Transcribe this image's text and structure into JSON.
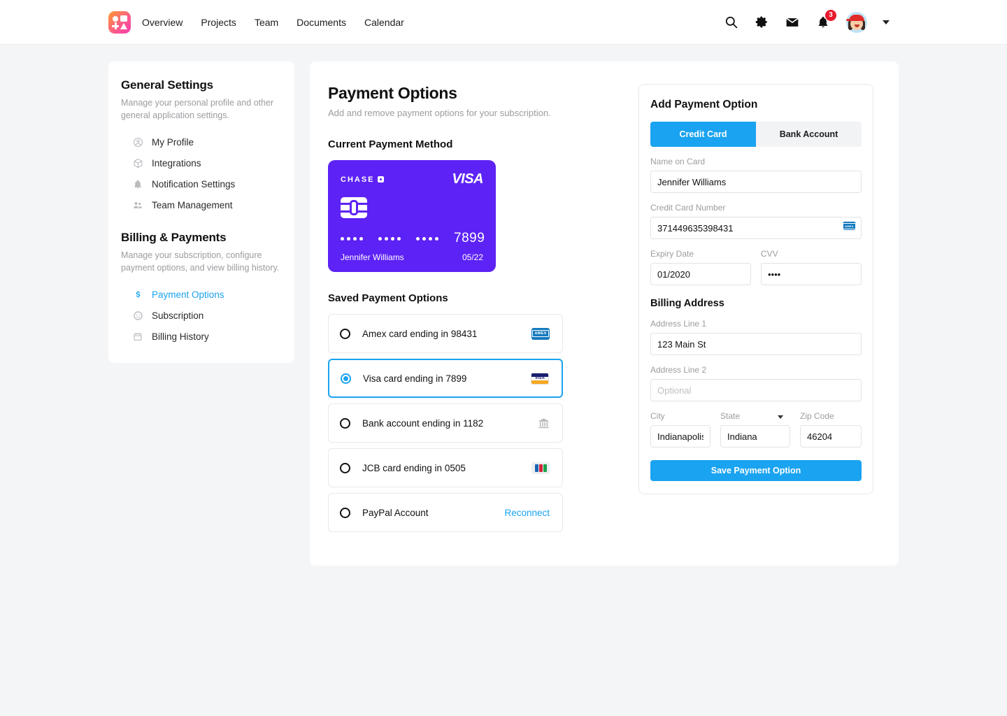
{
  "header": {
    "logo_icon": "app-logo",
    "nav": [
      {
        "label": "Overview"
      },
      {
        "label": "Projects"
      },
      {
        "label": "Team"
      },
      {
        "label": "Documents"
      },
      {
        "label": "Calendar"
      }
    ],
    "icons": {
      "search": "search-icon",
      "settings": "gear-icon",
      "mail": "mail-icon",
      "notifications": "bell-icon"
    },
    "notification_count": "3"
  },
  "sidebar": {
    "general": {
      "title": "General Settings",
      "description": "Manage your personal profile and other general application settings.",
      "items": [
        {
          "label": "My Profile",
          "icon": "user-circle-icon",
          "active": false
        },
        {
          "label": "Integrations",
          "icon": "box-icon",
          "active": false
        },
        {
          "label": "Notification Settings",
          "icon": "bell-icon",
          "active": false
        },
        {
          "label": "Team Management",
          "icon": "people-icon",
          "active": false
        }
      ]
    },
    "billing": {
      "title": "Billing & Payments",
      "description": "Manage your subscription, configure payment options, and view billing history.",
      "items": [
        {
          "label": "Payment Options",
          "icon": "dollar-icon",
          "active": true
        },
        {
          "label": "Subscription",
          "icon": "circle-icon",
          "active": false
        },
        {
          "label": "Billing History",
          "icon": "calendar-icon",
          "active": false
        }
      ]
    }
  },
  "main": {
    "title": "Payment Options",
    "subtitle": "Add and remove payment options for your subscription.",
    "current_section_title": "Current Payment Method",
    "card": {
      "bank": "CHASE",
      "brand": "VISA",
      "masked_groups": [
        "••••",
        "••••",
        "••••"
      ],
      "last4": "7899",
      "holder": "Jennifer Williams",
      "expiry": "05/22",
      "color": "#5d22f5"
    },
    "saved_section_title": "Saved Payment Options",
    "saved_options": [
      {
        "label": "Amex card ending in 98431",
        "brand": "amex",
        "selected": false,
        "action": ""
      },
      {
        "label": "Visa card ending in 7899",
        "brand": "visa",
        "selected": true,
        "action": ""
      },
      {
        "label": "Bank account ending in 1182",
        "brand": "bank",
        "selected": false,
        "action": ""
      },
      {
        "label": "JCB card ending in 0505",
        "brand": "jcb",
        "selected": false,
        "action": ""
      },
      {
        "label": "PayPal Account",
        "brand": "none",
        "selected": false,
        "action": "Reconnect"
      }
    ]
  },
  "form": {
    "title": "Add Payment Option",
    "tabs": [
      {
        "label": "Credit Card",
        "active": true
      },
      {
        "label": "Bank Account",
        "active": false
      }
    ],
    "fields": {
      "name_label": "Name on Card",
      "name_value": "Jennifer Williams",
      "card_number_label": "Credit Card Number",
      "card_number_value": "371449635398431",
      "card_number_brand": "amex-icon",
      "expiry_label": "Expiry Date",
      "expiry_value": "01/2020",
      "cvv_label": "CVV",
      "cvv_value": "••••",
      "billing_section": "Billing Address",
      "address1_label": "Address Line 1",
      "address1_value": "123 Main St",
      "address2_label": "Address Line 2",
      "address2_placeholder": "Optional",
      "address2_value": "",
      "city_label": "City",
      "city_value": "Indianapolis",
      "state_label": "State",
      "state_value": "Indiana",
      "zip_label": "Zip Code",
      "zip_value": "46204"
    },
    "save_label": "Save Payment Option"
  },
  "colors": {
    "accent": "#1aa3f0",
    "card_purple": "#5d22f5",
    "badge_red": "#e8192c",
    "page_bg": "#f4f5f7"
  }
}
